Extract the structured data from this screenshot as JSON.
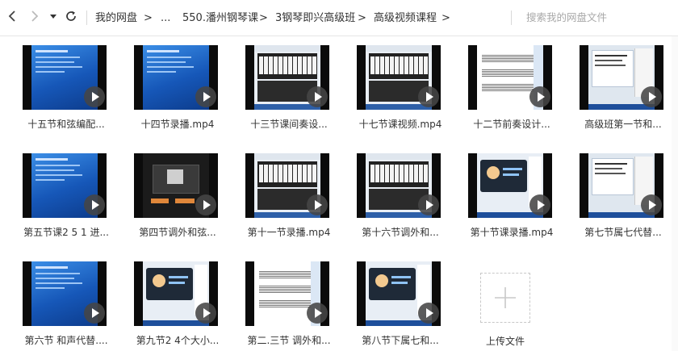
{
  "toolbar": {
    "back_icon": "chevron-left-icon",
    "forward_icon": "chevron-right-icon",
    "history_icon": "caret-down-icon",
    "refresh_icon": "refresh-icon",
    "breadcrumb": [
      {
        "label": "我的网盘"
      },
      {
        "label": ">"
      },
      {
        "label": "..."
      },
      {
        "label": "550.潘州钢琴课"
      },
      {
        "label": ">"
      },
      {
        "label": "3钢琴即兴高级班"
      },
      {
        "label": ">"
      },
      {
        "label": "高级视频课程"
      },
      {
        "label": ">"
      }
    ],
    "search_placeholder": "搜索我的网盘文件"
  },
  "files": [
    {
      "name": "十五节和弦编配...",
      "thumb": "blue"
    },
    {
      "name": "十四节录播.mp4",
      "thumb": "blue"
    },
    {
      "name": "十三节课间奏设...",
      "thumb": "piano"
    },
    {
      "name": "十七节课视频.mp4",
      "thumb": "piano"
    },
    {
      "name": "十二节前奏设计...",
      "thumb": "sheet"
    },
    {
      "name": "高级班第一节和...",
      "thumb": "desktop"
    },
    {
      "name": "第五节课2 5 1 进...",
      "thumb": "blue"
    },
    {
      "name": "第四节调外和弦...",
      "thumb": "dark"
    },
    {
      "name": "第十一节录播.mp4",
      "thumb": "piano"
    },
    {
      "name": "第十六节调外和...",
      "thumb": "piano"
    },
    {
      "name": "第十节课录播.mp4",
      "thumb": "cartoon"
    },
    {
      "name": "第七节属七代替...",
      "thumb": "desktop"
    },
    {
      "name": "第六节 和声代替....",
      "thumb": "blue"
    },
    {
      "name": "第九节2 4个大小...",
      "thumb": "cartoon"
    },
    {
      "name": "第二.三节 调外和...",
      "thumb": "sheet"
    },
    {
      "name": "第八节下属七和...",
      "thumb": "cartoon"
    }
  ],
  "upload": {
    "label": "上传文件",
    "icon": "plus-icon"
  },
  "colors": {
    "accent_blue": "#1f6fd1",
    "play_overlay": "#464646",
    "border": "#e6e6e6"
  }
}
